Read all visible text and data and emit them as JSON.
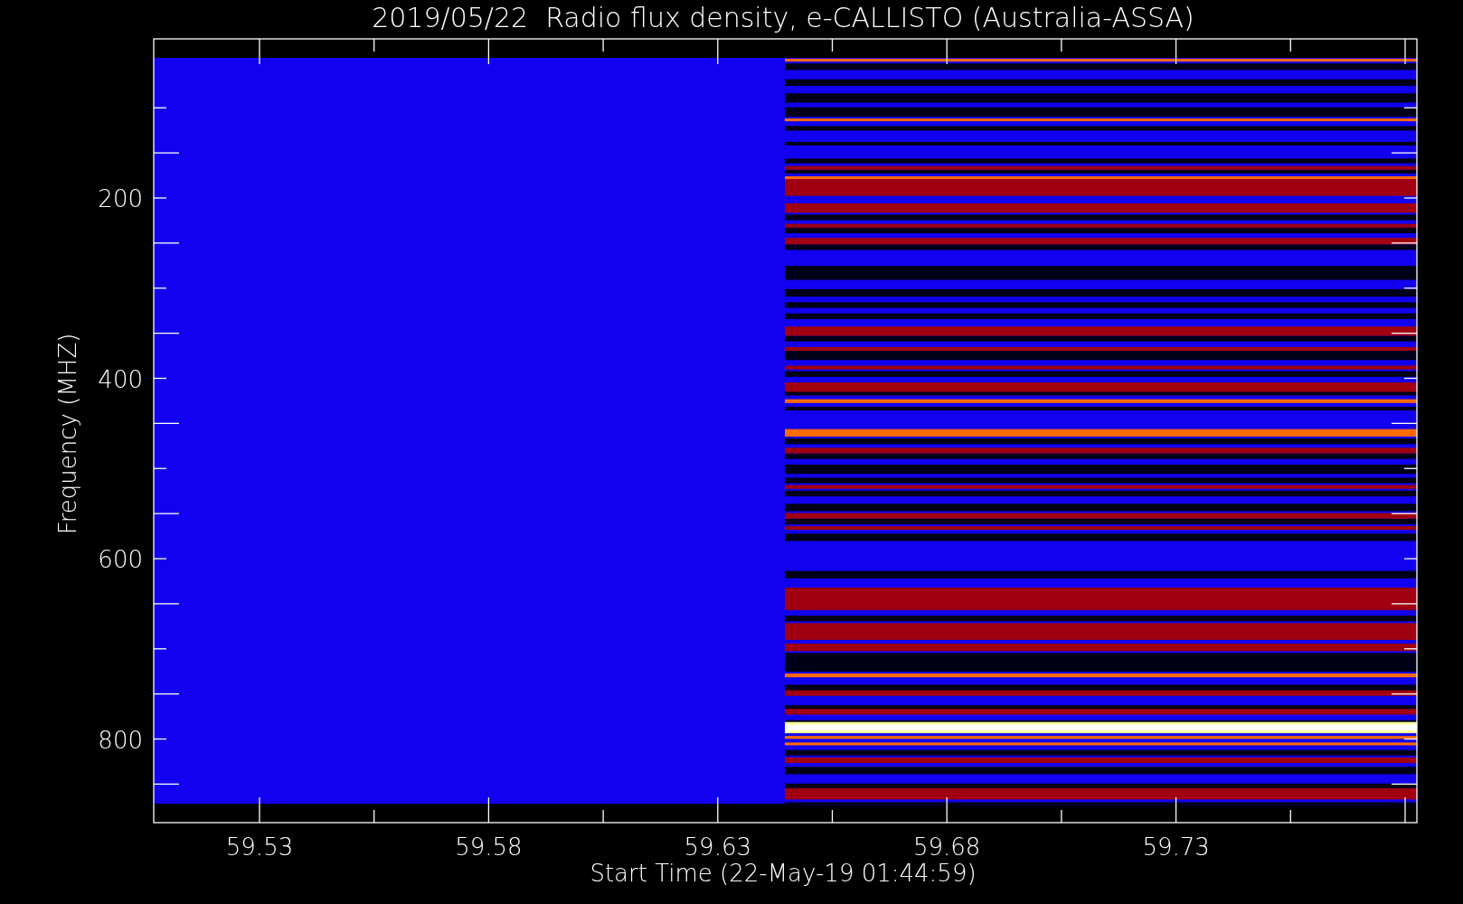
{
  "title": "2019/05/22  Radio flux density, e-CALLISTO (Australia-ASSA)",
  "y_axis": {
    "label": "Frequency (MHZ)",
    "ticks": [
      "200",
      "400",
      "600",
      "800"
    ]
  },
  "x_axis": {
    "label": "Start Time (22-May-19 01:44:59)",
    "ticks": [
      "59.53",
      "59.58",
      "59.63",
      "59.68",
      "59.73"
    ]
  }
}
